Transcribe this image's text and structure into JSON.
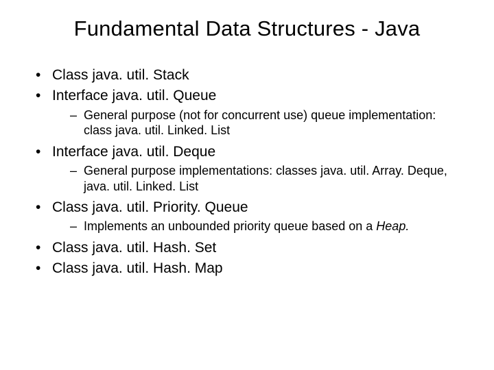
{
  "title": "Fundamental Data Structures - Java",
  "items": [
    {
      "text": "Class java. util. Stack"
    },
    {
      "text": "Interface java. util. Queue",
      "sub": [
        {
          "text": "General purpose (not for concurrent use) queue implementation: class java. util. Linked. List"
        }
      ]
    },
    {
      "text": "Interface java. util. Deque",
      "sub": [
        {
          "text": "General purpose implementations: classes java. util. Array. Deque, java. util. Linked. List"
        }
      ]
    },
    {
      "text": "Class java. util. Priority. Queue",
      "sub": [
        {
          "text_prefix": "Implements an unbounded priority queue based on a ",
          "text_italic": "Heap.",
          "text_suffix": ""
        }
      ]
    },
    {
      "text": "Class java. util. Hash. Set"
    },
    {
      "text": "Class java. util. Hash. Map"
    }
  ]
}
